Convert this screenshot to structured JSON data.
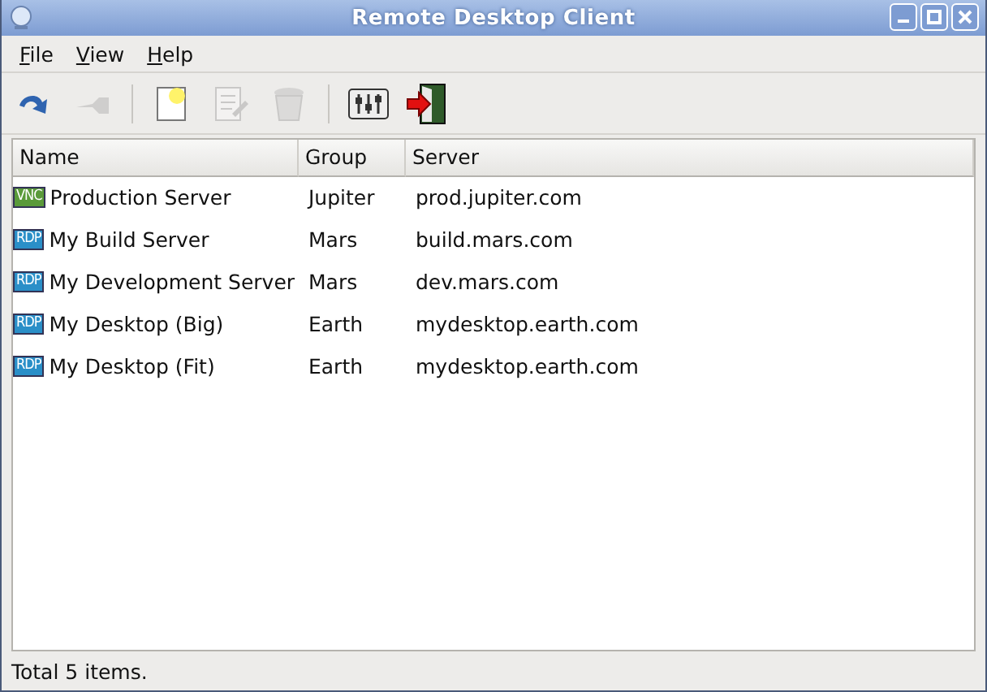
{
  "window": {
    "title": "Remote Desktop Client"
  },
  "menu": [
    {
      "label": "File"
    },
    {
      "label": "View"
    },
    {
      "label": "Help"
    }
  ],
  "toolbar": [
    {
      "kind": "refresh",
      "disabled": false
    },
    {
      "kind": "connect",
      "disabled": true
    },
    {
      "kind": "separator"
    },
    {
      "kind": "new",
      "disabled": false
    },
    {
      "kind": "edit",
      "disabled": true
    },
    {
      "kind": "delete",
      "disabled": true
    },
    {
      "kind": "separator"
    },
    {
      "kind": "preferences",
      "disabled": false
    },
    {
      "kind": "quit",
      "disabled": false
    }
  ],
  "table": {
    "columns": [
      "Name",
      "Group",
      "Server"
    ],
    "rows": [
      {
        "protocol": "VNC",
        "color": "#5a9a3a",
        "name": "Production Server",
        "group": "Jupiter",
        "server": "prod.jupiter.com"
      },
      {
        "protocol": "RDP",
        "color": "#2a8fc8",
        "name": "My Build Server",
        "group": "Mars",
        "server": "build.mars.com"
      },
      {
        "protocol": "RDP",
        "color": "#2a8fc8",
        "name": "My Development Server",
        "group": "Mars",
        "server": "dev.mars.com"
      },
      {
        "protocol": "RDP",
        "color": "#2a8fc8",
        "name": "My Desktop (Big)",
        "group": "Earth",
        "server": "mydesktop.earth.com"
      },
      {
        "protocol": "RDP",
        "color": "#2a8fc8",
        "name": "My Desktop (Fit)",
        "group": "Earth",
        "server": "mydesktop.earth.com"
      }
    ]
  },
  "status_bar": "Total 5 items."
}
